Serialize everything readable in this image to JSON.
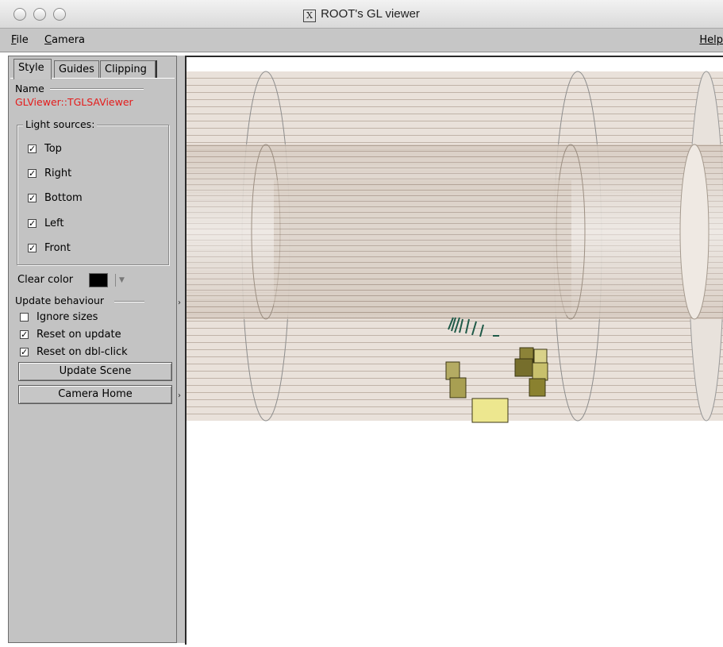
{
  "window": {
    "title": "ROOT's GL viewer",
    "x_glyph": "X"
  },
  "menubar": {
    "file": "ile",
    "file_mnemonic": "F",
    "camera": "amera",
    "camera_mnemonic": "C",
    "help": "Help"
  },
  "tabs": [
    {
      "label": "Style"
    },
    {
      "label": "Guides"
    },
    {
      "label": "Clipping"
    }
  ],
  "style_tab": {
    "name_label": "Name",
    "name_value": "GLViewer::TGLSAViewer",
    "name_color": "#e41b1b",
    "light_sources": {
      "title": "Light sources:",
      "items": [
        {
          "label": "Top",
          "checked": true
        },
        {
          "label": "Right",
          "checked": true
        },
        {
          "label": "Bottom",
          "checked": true
        },
        {
          "label": "Left",
          "checked": true
        },
        {
          "label": "Front",
          "checked": true
        }
      ]
    },
    "clear_color": {
      "label": "Clear color",
      "value": "#000000"
    },
    "update_behaviour": {
      "title": "Update behaviour",
      "items": [
        {
          "label": "Ignore sizes",
          "checked": false
        },
        {
          "label": "Reset on update",
          "checked": true
        },
        {
          "label": "Reset on dbl-click",
          "checked": true
        }
      ]
    },
    "update_scene_button": "Update Scene",
    "camera_home_button": "Camera Home"
  },
  "colors": {
    "panel_bg": "#c3c3c3",
    "cylinder_fill": "#d8cfc4",
    "box_dark": "#8c8338",
    "box_light": "#d9d28a"
  }
}
